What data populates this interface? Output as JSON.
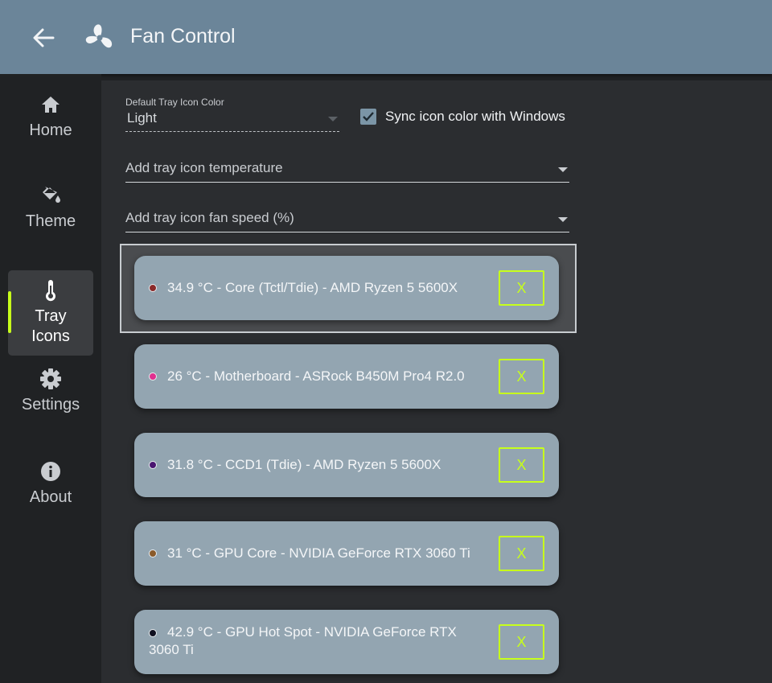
{
  "app": {
    "title": "Fan Control",
    "accent_color": "#c7ff1b",
    "header_color": "#6b8599"
  },
  "nav": {
    "items": [
      {
        "label": "Home",
        "icon": "home-icon"
      },
      {
        "label": "Theme",
        "icon": "paint-bucket-icon"
      },
      {
        "label": "Tray\nIcons",
        "icon": "thermometer-icon",
        "active": true
      },
      {
        "label": "Settings",
        "icon": "gear-icon"
      },
      {
        "label": "About",
        "icon": "info-icon"
      }
    ]
  },
  "tray": {
    "color_label": "Default Tray Icon Color",
    "color_value": "Light",
    "sync_label": "Sync icon color with Windows",
    "sync_checked": true,
    "add_temperature_placeholder": "Add tray icon temperature",
    "add_fan_speed_placeholder": "Add tray icon fan speed (%)",
    "remove_label": "X",
    "sensors": [
      {
        "text": "34.9 °C - Core (Tctl/Tdie) - AMD Ryzen 5 5600X",
        "color": "#8b2a2a"
      },
      {
        "text": "26 °C - Motherboard - ASRock B450M Pro4 R2.0",
        "color": "#e0308f"
      },
      {
        "text": "31.8 °C - CCD1 (Tdie) - AMD Ryzen 5 5600X",
        "color": "#4a1570"
      },
      {
        "text": "31 °C - GPU Core - NVIDIA GeForce RTX 3060 Ti",
        "color": "#8a5a2a"
      },
      {
        "text": "42.9 °C - GPU Hot Spot - NVIDIA GeForce RTX 3060 Ti",
        "color": "#101020"
      }
    ]
  }
}
